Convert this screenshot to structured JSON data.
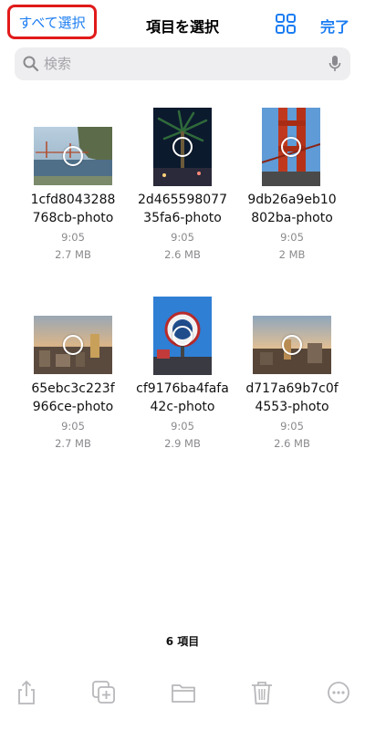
{
  "header": {
    "select_all": "すべて選択",
    "title": "項目を選択",
    "done": "完了"
  },
  "search": {
    "placeholder": "検索"
  },
  "items": [
    {
      "name_line1": "1cfd8043288",
      "name_line2": "768cb-photo",
      "time": "9:05",
      "size": "2.7 MB"
    },
    {
      "name_line1": "2d465598077",
      "name_line2": "35fa6-photo",
      "time": "9:05",
      "size": "2.6 MB"
    },
    {
      "name_line1": "9db26a9eb10",
      "name_line2": "802ba-photo",
      "time": "9:05",
      "size": "2 MB"
    },
    {
      "name_line1": "65ebc3c223f",
      "name_line2": "966ce-photo",
      "time": "9:05",
      "size": "2.7 MB"
    },
    {
      "name_line1": "cf9176ba4fafa",
      "name_line2": "42c-photo",
      "time": "9:05",
      "size": "2.9 MB"
    },
    {
      "name_line1": "d717a69b7c0f",
      "name_line2": "4553-photo",
      "time": "9:05",
      "size": "2.6 MB"
    }
  ],
  "footer": {
    "count": "6 項目"
  },
  "icons": {
    "grid": "grid-view-icon",
    "share": "share-icon",
    "duplicate": "duplicate-icon",
    "folder": "folder-icon",
    "trash": "trash-icon",
    "more": "more-icon"
  },
  "colors": {
    "accent": "#1a7cf2",
    "highlight": "#e11a1a"
  }
}
